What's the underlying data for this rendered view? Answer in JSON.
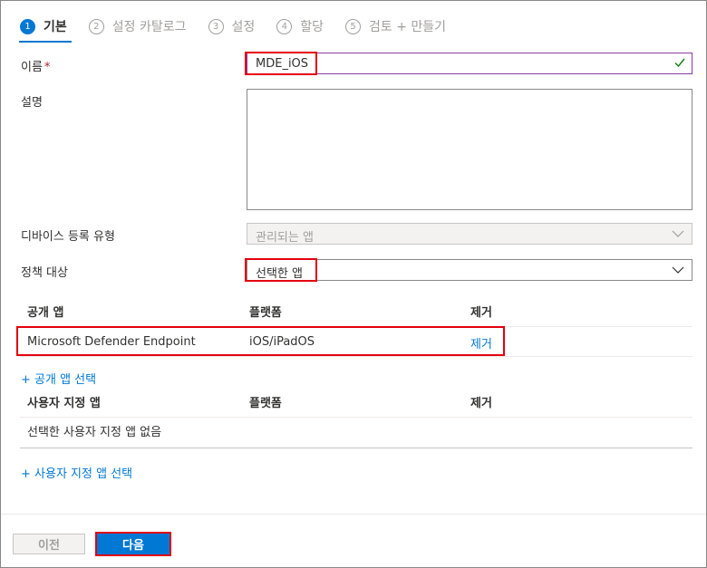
{
  "steps": [
    {
      "num": "1",
      "label": "기본",
      "active": true
    },
    {
      "num": "2",
      "label": "설정 카탈로그"
    },
    {
      "num": "3",
      "label": "설정"
    },
    {
      "num": "4",
      "label": "할당"
    },
    {
      "num": "5",
      "label": "검토 + 만들기"
    }
  ],
  "form": {
    "name_label": "이름",
    "required_mark": "*",
    "name_value": "MDE_iOS",
    "description_label": "설명",
    "enrollment_label": "디바이스 등록 유형",
    "enrollment_value": "관리되는 앱",
    "target_label": "정책 대상",
    "target_value": "선택한 앱"
  },
  "public_apps": {
    "col_app": "공개 앱",
    "col_platform": "플랫폼",
    "col_remove": "제거",
    "rows": [
      {
        "app": "Microsoft Defender Endpoint",
        "platform": "iOS/iPadOS",
        "remove": "제거"
      }
    ],
    "add_link": "+ 공개 앱 선택"
  },
  "custom_apps": {
    "col_app": "사용자 지정 앱",
    "col_platform": "플랫폼",
    "col_remove": "제거",
    "empty_text": "선택한 사용자 지정 앱 없음",
    "add_link": "+ 사용자 지정 앱 선택"
  },
  "footer": {
    "prev_label": "이전",
    "next_label": "다음"
  },
  "colors": {
    "accent": "#0078d4",
    "highlight": "#e3000f",
    "valid": "#107c10"
  }
}
